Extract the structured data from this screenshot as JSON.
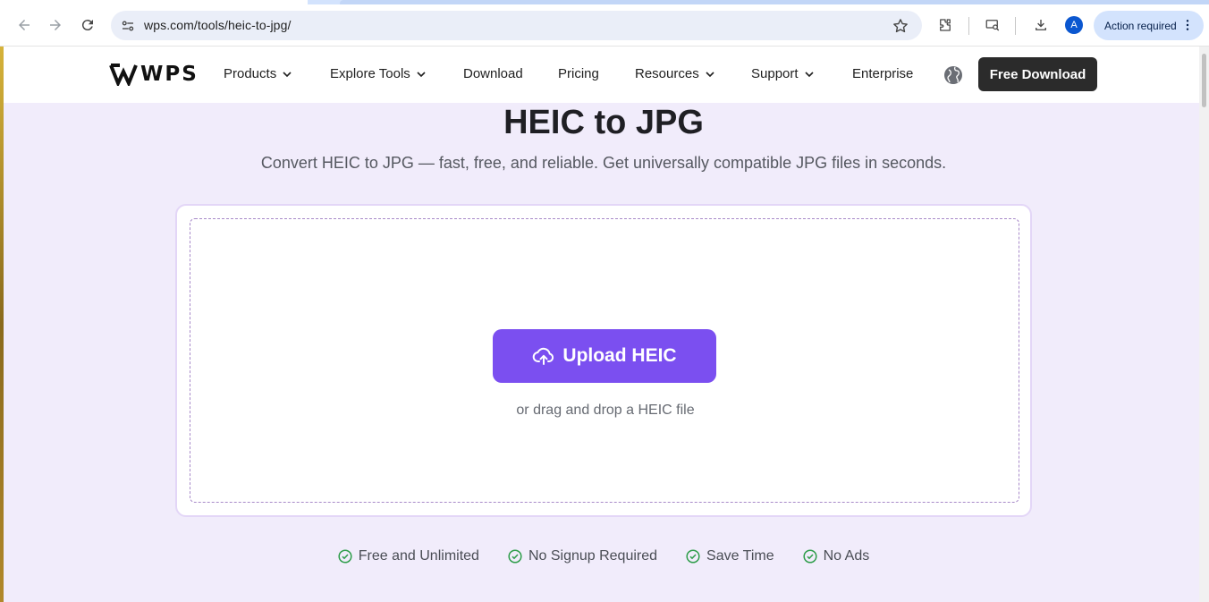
{
  "browser": {
    "url": "wps.com/tools/heic-to-jpg/",
    "avatar_letter": "A",
    "action_required_label": "Action required"
  },
  "nav": {
    "logo_text": "WPS",
    "items": [
      {
        "label": "Products",
        "has_dropdown": true
      },
      {
        "label": "Explore Tools",
        "has_dropdown": true
      },
      {
        "label": "Download",
        "has_dropdown": false
      },
      {
        "label": "Pricing",
        "has_dropdown": false
      },
      {
        "label": "Resources",
        "has_dropdown": true
      },
      {
        "label": "Support",
        "has_dropdown": true
      },
      {
        "label": "Enterprise",
        "has_dropdown": false
      }
    ],
    "cta_label": "Free Download"
  },
  "hero": {
    "title": "HEIC to JPG",
    "subtitle": "Convert HEIC to JPG — fast, free, and reliable. Get universally compatible JPG files in seconds."
  },
  "upload": {
    "button_label": "Upload HEIC",
    "drag_text": "or drag and drop a HEIC file"
  },
  "features": [
    {
      "label": "Free and Unlimited",
      "icon": "check-circle-icon"
    },
    {
      "label": "No Signup Required",
      "icon": "check-circle-icon"
    },
    {
      "label": "Save Time",
      "icon": "check-circle-icon"
    },
    {
      "label": "No Ads",
      "icon": "check-circle-icon"
    }
  ],
  "colors": {
    "accent": "#7b4ff0",
    "page_bg": "#f1ecfb",
    "check_green": "#2e9d4a",
    "cta_bg": "#2b2b2b"
  }
}
